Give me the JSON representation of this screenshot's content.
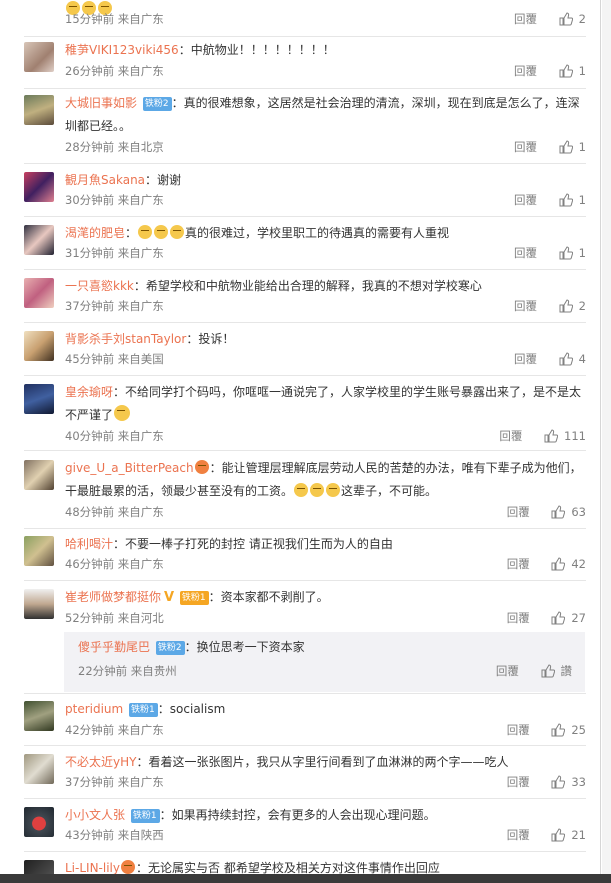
{
  "labels": {
    "reply": "回覆"
  },
  "comments": [
    {
      "user": "",
      "badge": "",
      "text": "",
      "time": "15分钟前",
      "loc": "来自广东",
      "likes": "2"
    },
    {
      "user": "稚芛VIKI123viki456",
      "badge": "",
      "text": "中航物业！！！！！！！！",
      "time": "26分钟前",
      "loc": "来自广东",
      "likes": "1"
    },
    {
      "user": "大城旧事如影",
      "badge": "铁粉2",
      "text": "真的很难想象，这居然是社会治理的清流，深圳，现在到底是怎么了，连深圳都已经。。",
      "time": "28分钟前",
      "loc": "来自北京",
      "likes": "1"
    },
    {
      "user": "観月魚Sakana",
      "badge": "",
      "text": "谢谢",
      "time": "30分钟前",
      "loc": "来自广东",
      "likes": "1"
    },
    {
      "user": "渴滗的肥皂",
      "badge": "",
      "text": "真的很难过，学校里职工的待遇真的需要有人重视",
      "time": "31分钟前",
      "loc": "来自广东",
      "likes": "1"
    },
    {
      "user": "一只喜慾kkk",
      "badge": "",
      "text": "希望学校和中航物业能给出合理的解释，我真的不想对学校寒心",
      "time": "37分钟前",
      "loc": "来自广东",
      "likes": "2"
    },
    {
      "user": "背影杀手刘stanTaylor",
      "badge": "",
      "text": "投诉！",
      "time": "45分钟前",
      "loc": "来自美国",
      "likes": "4"
    },
    {
      "user": "皇余瑜呀",
      "badge": "",
      "text": "不给同学打个码吗，你哐哐一通说完了，人家学校里的学生账号暴露出来了，是不是太不严谨了",
      "time": "40分钟前",
      "loc": "来自广东",
      "likes": "111"
    },
    {
      "user": "give_U_a_BitterPeach",
      "badge": "",
      "text": "能让管理层理解底层劳动人民的苦楚的办法，唯有下辈子成为他们，干最脏最累的活，领最少甚至没有的工资。",
      "text2": "这辈子，不可能。",
      "time": "48分钟前",
      "loc": "来自广东",
      "likes": "63"
    },
    {
      "user": "哈利喝汁",
      "badge": "",
      "text": "不要一棒子打死的封控 请正视我们生而为人的自由",
      "time": "46分钟前",
      "loc": "来自广东",
      "likes": "42"
    },
    {
      "user": "崔老师做梦都挺你",
      "badge": "铁粉1",
      "text": "资本家都不剥削了。",
      "time": "52分钟前",
      "loc": "来自河北",
      "likes": "27"
    },
    {
      "user": "pteridium",
      "badge": "铁粉1",
      "text": "socialism",
      "time": "42分钟前",
      "loc": "来自广东",
      "likes": "25"
    },
    {
      "user": "不必太近yHY",
      "badge": "",
      "text": "看着这一张张图片，我只从字里行间看到了血淋淋的两个字——吃人",
      "time": "37分钟前",
      "loc": "来自广东",
      "likes": "33"
    },
    {
      "user": "小小文人张",
      "badge": "铁粉1",
      "text": "如果再持续封控，会有更多的人会出现心理问题。",
      "time": "43分钟前",
      "loc": "来自陕西",
      "likes": "21"
    },
    {
      "user": "Li-LIN-lily",
      "badge": "",
      "text": "无论属实与否 都希望学校及相关方对这件事情作出回应"
    }
  ],
  "subreply": {
    "user": "傻乎乎勤尾巴",
    "badge": "铁粉2",
    "text": "换位思考一下资本家",
    "time": "22分钟前",
    "loc": "来自贵州",
    "likes": "讚"
  },
  "colors": {
    "username": "#eb7350",
    "badge": "#5ca8e6",
    "meta": "#808080"
  }
}
